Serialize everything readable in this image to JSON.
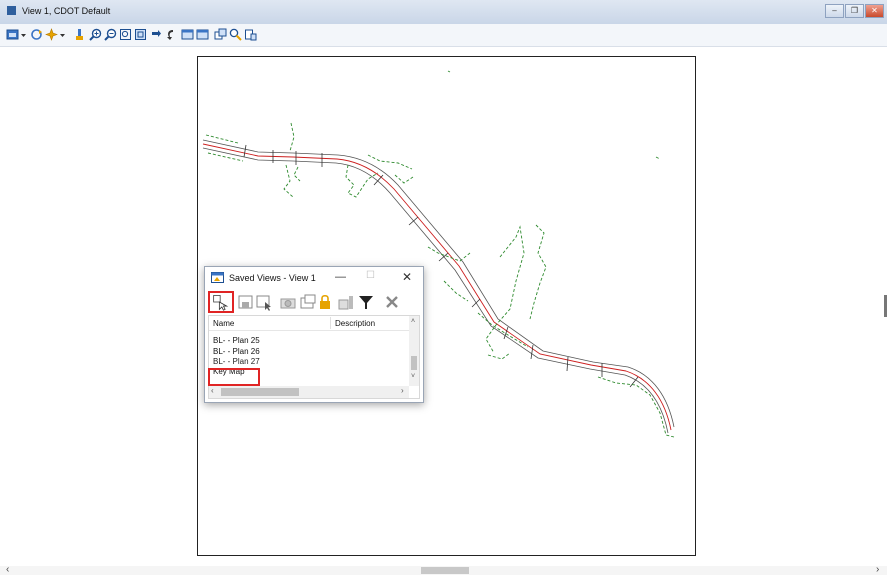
{
  "window": {
    "title": "View 1, CDOT Default",
    "controls": [
      "minimize-icon",
      "restore-icon",
      "close-icon"
    ]
  },
  "toolbar": {
    "icons": [
      "view-attributes-icon",
      "dropdown-arrow-icon",
      "update-view-icon",
      "view-display-mode-icon",
      "dropdown-arrow-icon",
      "pan-icon",
      "zoom-in-icon",
      "zoom-out-icon",
      "window-area-icon",
      "fit-view-icon",
      "rotate-view-icon",
      "undo-view-icon",
      "previous-view-icon",
      "next-view-icon",
      "copy-view-icon",
      "zoom-selection-icon",
      "saved-views-icon"
    ]
  },
  "dialog": {
    "title": "Saved Views - View 1",
    "min_glyph": "—",
    "max_glyph": "☐",
    "close_glyph": "✕",
    "tools": [
      "apply-view-icon",
      "save-view-icon",
      "select-view-icon",
      "camera-icon",
      "window-icon",
      "lock-icon",
      "properties-icon",
      "filter-icon",
      "delete-icon"
    ],
    "columns": {
      "name": "Name",
      "description": "Description"
    },
    "rows": [
      "BL- - Plan 25",
      "BL- - Plan 26",
      "BL- - Plan 27",
      "Key Map"
    ],
    "selected_row": "Key Map",
    "scroll_up": "˄",
    "scroll_down": "˅",
    "scroll_left": "‹",
    "scroll_right": "›"
  },
  "scrollbar": {
    "left_arrow": "‹",
    "right_arrow": "›"
  },
  "colors": {
    "highlight": "#e02424",
    "alignment": "#cc1f1f",
    "edge": "#555555",
    "vegetation": "#2e8a2e"
  }
}
